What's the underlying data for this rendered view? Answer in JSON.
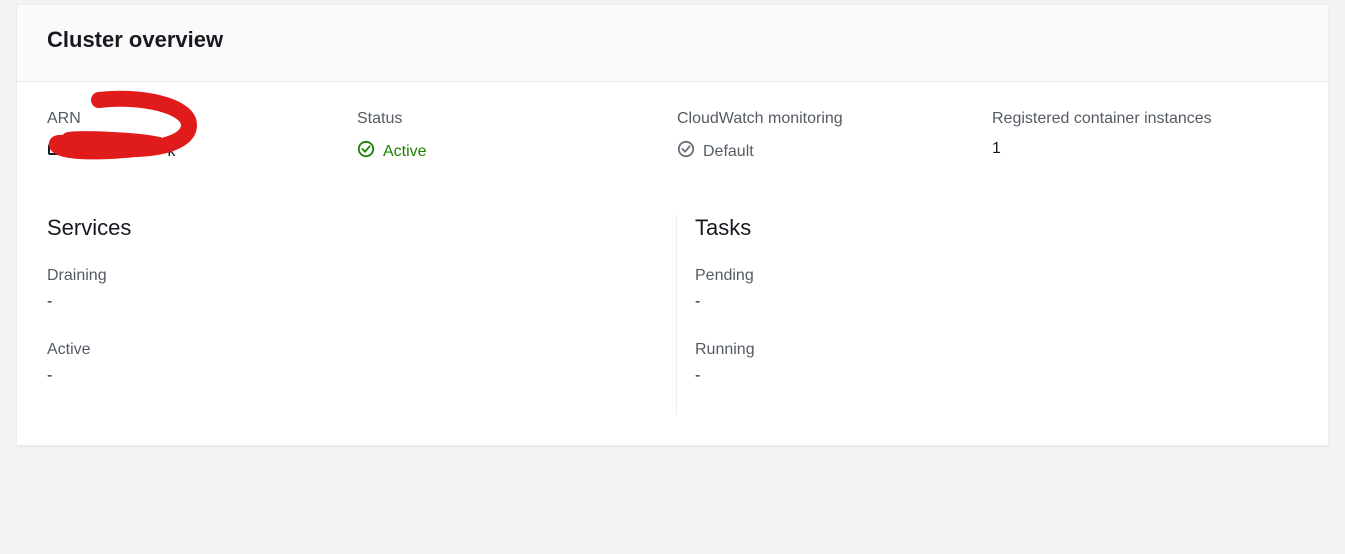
{
  "header": {
    "title": "Cluster overview"
  },
  "info": {
    "arn": {
      "label": "ARN",
      "value": "k"
    },
    "status": {
      "label": "Status",
      "value": "Active"
    },
    "cloudwatch": {
      "label": "CloudWatch monitoring",
      "value": "Default"
    },
    "registered_instances": {
      "label": "Registered container instances",
      "value": "1"
    }
  },
  "services": {
    "title": "Services",
    "draining": {
      "label": "Draining",
      "value": "-"
    },
    "active": {
      "label": "Active",
      "value": "-"
    }
  },
  "tasks": {
    "title": "Tasks",
    "pending": {
      "label": "Pending",
      "value": "-"
    },
    "running": {
      "label": "Running",
      "value": "-"
    }
  }
}
